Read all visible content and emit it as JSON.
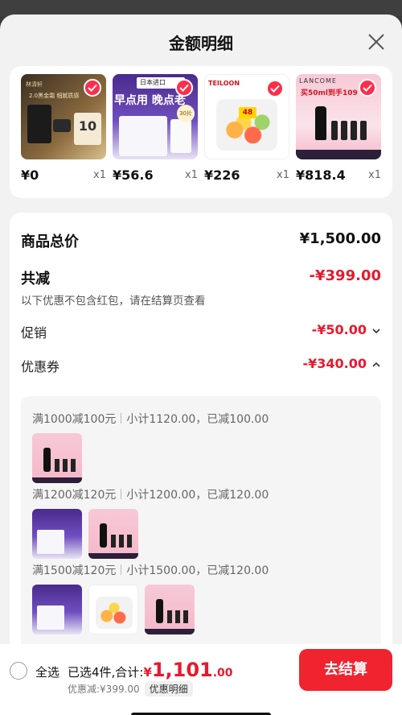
{
  "header": {
    "title": "金额明细"
  },
  "products": [
    {
      "price": "¥0",
      "qty": "x1",
      "image_text": "2.0黑金霜 细腻质感",
      "image_badge": "10",
      "brand": "林清轩"
    },
    {
      "price": "¥56.6",
      "qty": "x1",
      "image_text": "早点用 晚点老",
      "image_tag": "日本进口",
      "image_badge": "30片"
    },
    {
      "price": "¥226",
      "qty": "x1",
      "brand": "TEILOON",
      "image_badge": "48"
    },
    {
      "price": "¥818.4",
      "qty": "x1",
      "brand": "LANCOME",
      "image_text": "买50ml到手109"
    }
  ],
  "detail": {
    "goods_total_label": "商品总价",
    "goods_total_value": "¥1,500.00",
    "reduce_label": "共减",
    "reduce_value": "-¥399.00",
    "note": "以下优惠不包含红包，请在结算页查看",
    "promo_label": "促销",
    "promo_value": "-¥50.00",
    "coupon_label": "优惠券",
    "coupon_value": "-¥340.00"
  },
  "coupon_tiers": [
    {
      "rule": "满1000减100元",
      "summary": "小计1120.00，已减100.00"
    },
    {
      "rule": "满1200减120元",
      "summary": "小计1200.00，已减120.00"
    },
    {
      "rule": "满1500减120元",
      "summary": "小计1500.00，已减120.00"
    }
  ],
  "bottom": {
    "select_all": "全选",
    "selected_text": "已选4件,合计:",
    "total_symbol": "¥",
    "total_int": "1,101",
    "total_dec": ".00",
    "discount_note": "优惠减:¥399.00",
    "detail_link": "优惠明细",
    "checkout": "去结算"
  },
  "colors": {
    "accent": "#f0232f",
    "discount_red": "#e8192c"
  }
}
